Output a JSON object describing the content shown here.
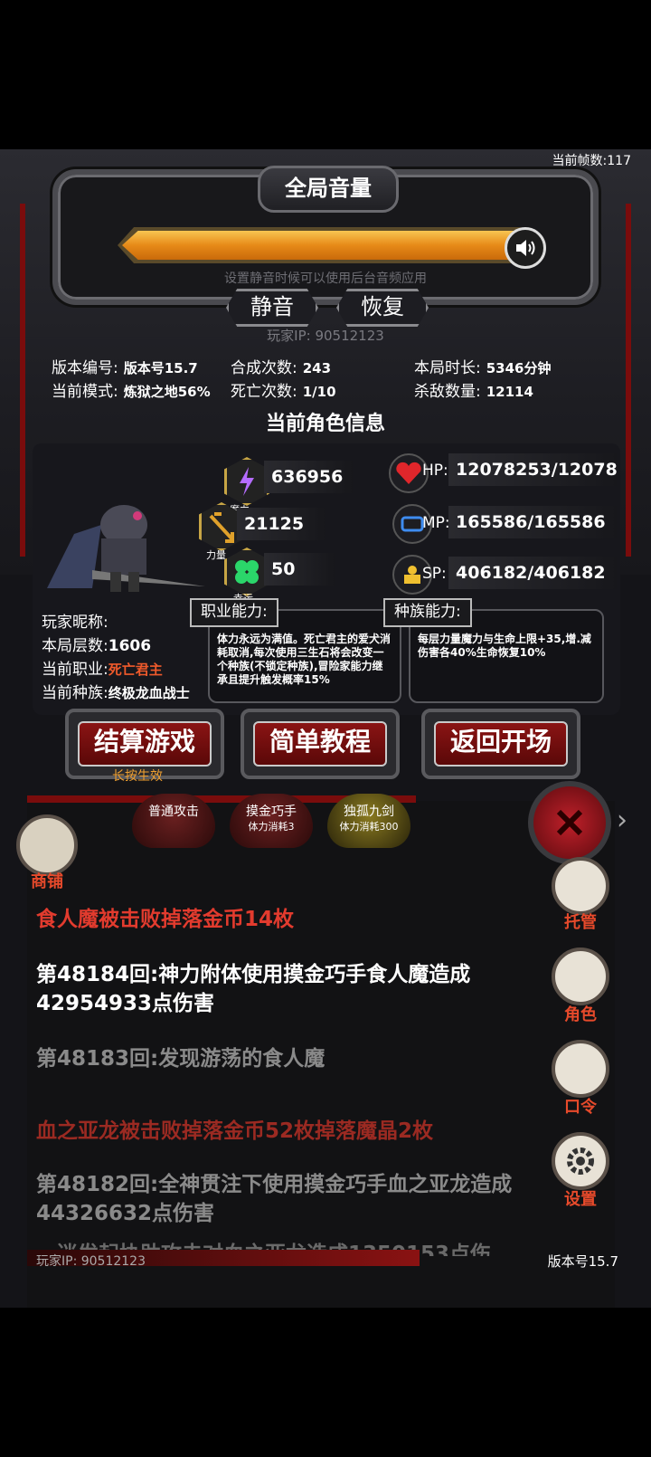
{
  "fps_label": "当前帧数:117",
  "volume": {
    "title": "全局音量",
    "level": 1.0,
    "hint": "设置静音时候可以使用后台音频应用",
    "mute_label": "静音",
    "restore_label": "恢复"
  },
  "player_ip_label": "玩家IP:  90512123",
  "stats": {
    "version_label": "版本编号:",
    "version_value": "版本号15.7",
    "mode_label": "当前模式:",
    "mode_value": "炼狱之地56%",
    "synth_label": "合成次数:",
    "synth_value": "243",
    "death_label": "死亡次数:",
    "death_value": "1/10",
    "duration_label": "本局时长:",
    "duration_value": "5346分钟",
    "kills_label": "杀敌数量:",
    "kills_value": "12114"
  },
  "character": {
    "section_title": "当前角色信息",
    "magic_value": "636956",
    "magic_label": "魔力",
    "power_value": "21125",
    "power_label": "力量",
    "luck_value": "50",
    "luck_label": "幸运",
    "hp_label": "HP:",
    "hp_value": "12078253/12078253",
    "mp_label": "MP:",
    "mp_value": "165586/165586",
    "sp_label": "SP:",
    "sp_value": "406182/406182",
    "nickname_label": "玩家昵称:",
    "floor_label": "本局层数:",
    "floor_value": "1606",
    "job_label": "当前职业:",
    "job_value": "死亡君主",
    "race_label": "当前种族:",
    "race_value": "终极龙血战士",
    "job_ability_title": "职业能力:",
    "job_ability_text": "体力永远为满值。死亡君主的爱犬消耗取消,每次使用三生石将会改变一个种族(不锁定种族),冒险家能力继承且提升触发概率15%",
    "race_ability_title": "种族能力:",
    "race_ability_text": "每层力量魔力与生命上限+35,增.减伤害各40%生命恢复10%"
  },
  "buttons": {
    "settle_label": "结算游戏",
    "settle_sub": "长按生效",
    "tutorial_label": "简单教程",
    "back_label": "返回开场"
  },
  "skills": [
    {
      "name": "普通攻击",
      "cost": ""
    },
    {
      "name": "摸金巧手",
      "cost": "体力消耗3"
    },
    {
      "name": "独孤九剑",
      "cost": "体力消耗300"
    }
  ],
  "side_menu": {
    "shop": "商铺",
    "auto": "托管",
    "role": "角色",
    "code": "口令",
    "settings": "设置"
  },
  "log": [
    {
      "text": "食人魔被击败掉落金币14枚",
      "color": "#e23b2e"
    },
    {
      "text": "第48184回:神力附体使用摸金巧手食人魔造成42954933点伤害",
      "color": "#ffffff"
    },
    {
      "text": "第48183回:发现游荡的食人魔",
      "color": "#8a8a8a"
    },
    {
      "text": "血之亚龙被击败掉落金币52枚掉落魔晶2枚",
      "color": "#9b2a22"
    },
    {
      "text": "第48182回:全神贯注下使用摸金巧手血之亚龙造成44326632点伤害",
      "color": "#8a8a8a"
    },
    {
      "text": "…迷发起协助攻击对血之亚龙造成1350153点伤",
      "color": "#6a6a6a"
    }
  ],
  "footer": {
    "ip": "玩家IP:   90512123",
    "version": "版本号15.7"
  }
}
